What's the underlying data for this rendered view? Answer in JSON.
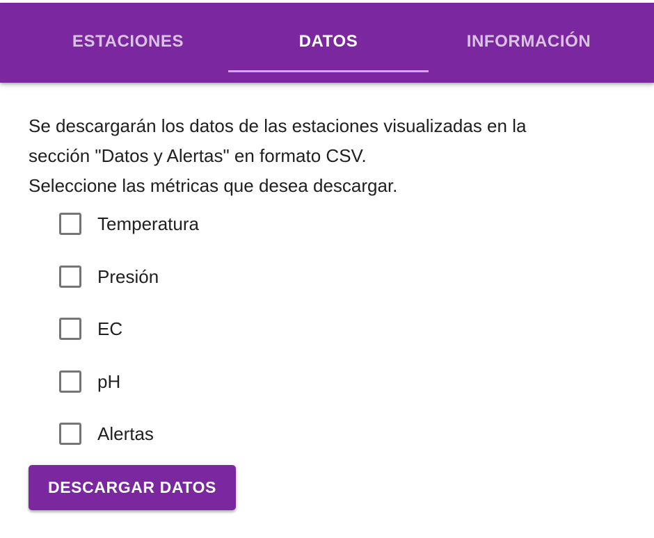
{
  "tabs": [
    {
      "label": "ESTACIONES",
      "active": false
    },
    {
      "label": "DATOS",
      "active": true
    },
    {
      "label": "INFORMACIÓN",
      "active": false
    }
  ],
  "description": {
    "line1": "Se descargarán los datos de las estaciones visualizadas en la",
    "line2": "sección \"Datos y Alertas\" en formato CSV.",
    "line3": "Seleccione las métricas que desea descargar."
  },
  "metrics": [
    {
      "label": "Temperatura",
      "checked": false
    },
    {
      "label": "Presión",
      "checked": false
    },
    {
      "label": "EC",
      "checked": false
    },
    {
      "label": "pH",
      "checked": false
    },
    {
      "label": "Alertas",
      "checked": false
    }
  ],
  "download_button": {
    "label": "DESCARGAR DATOS"
  },
  "colors": {
    "primary": "#7b27a0",
    "tab_indicator": "#d6a8ea",
    "text": "#202020",
    "checkbox_border": "#757575"
  }
}
